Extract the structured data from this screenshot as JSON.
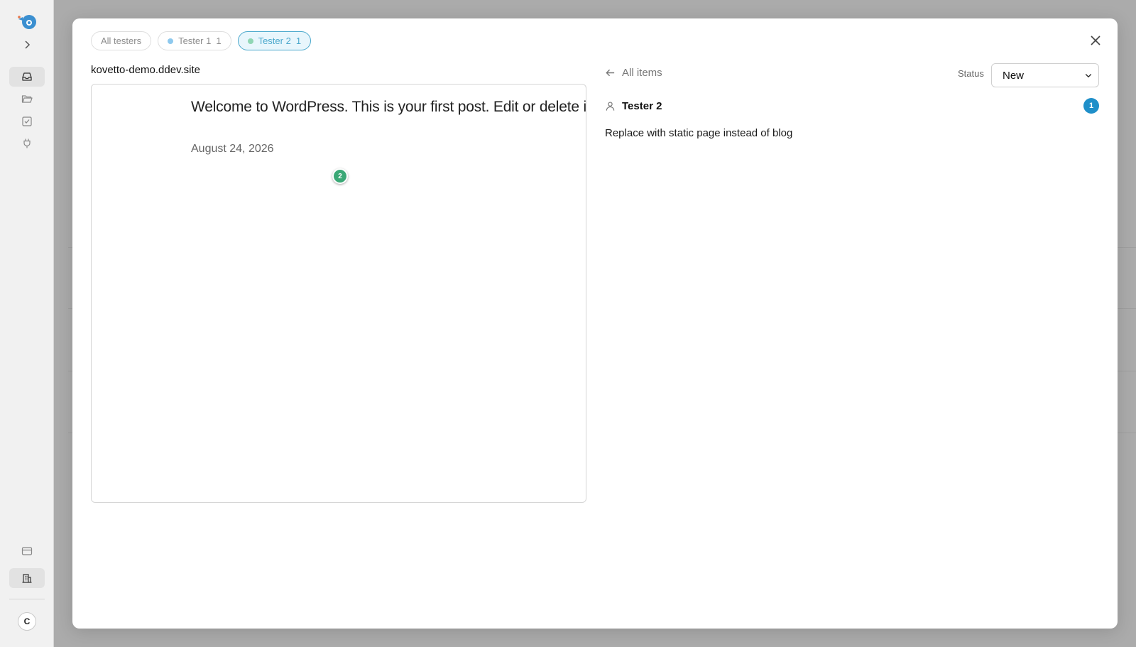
{
  "sidebar": {
    "logo": "chameleon-logo",
    "expand_icon": "chevron-right-icon",
    "items": [
      {
        "name": "inbox-icon",
        "active": true
      },
      {
        "name": "folder-icon",
        "active": false
      },
      {
        "name": "checkbox-icon",
        "active": false
      },
      {
        "name": "plug-icon",
        "active": false
      }
    ],
    "bottom_items": [
      {
        "name": "credit-card-icon",
        "active": false
      },
      {
        "name": "building-icon",
        "active": true
      }
    ],
    "avatar_initial": "C"
  },
  "filters": [
    {
      "label": "All testers",
      "count": "",
      "dot_color": "",
      "selected": false
    },
    {
      "label": "Tester 1",
      "count": "1",
      "dot_color": "#8ec9ee",
      "selected": false
    },
    {
      "label": "Tester 2",
      "count": "1",
      "dot_color": "#8fd6b4",
      "selected": true
    }
  ],
  "preview": {
    "site": "kovetto-demo.ddev.site",
    "post_title": "Welcome to WordPress. This is your first post. Edit or delete it, t",
    "post_date": "August 24, 2026",
    "marker_number": "2",
    "marker_color": "#3aa876"
  },
  "detail": {
    "back_label": "All items",
    "status_label": "Status",
    "status_value": "New",
    "tester_name": "Tester 2",
    "item_count": "1",
    "badge_color": "#1f8fc9",
    "comment": "Replace with static page instead of blog"
  },
  "colors": {
    "accent": "#4aa8cc",
    "overlay": "#ababab"
  }
}
